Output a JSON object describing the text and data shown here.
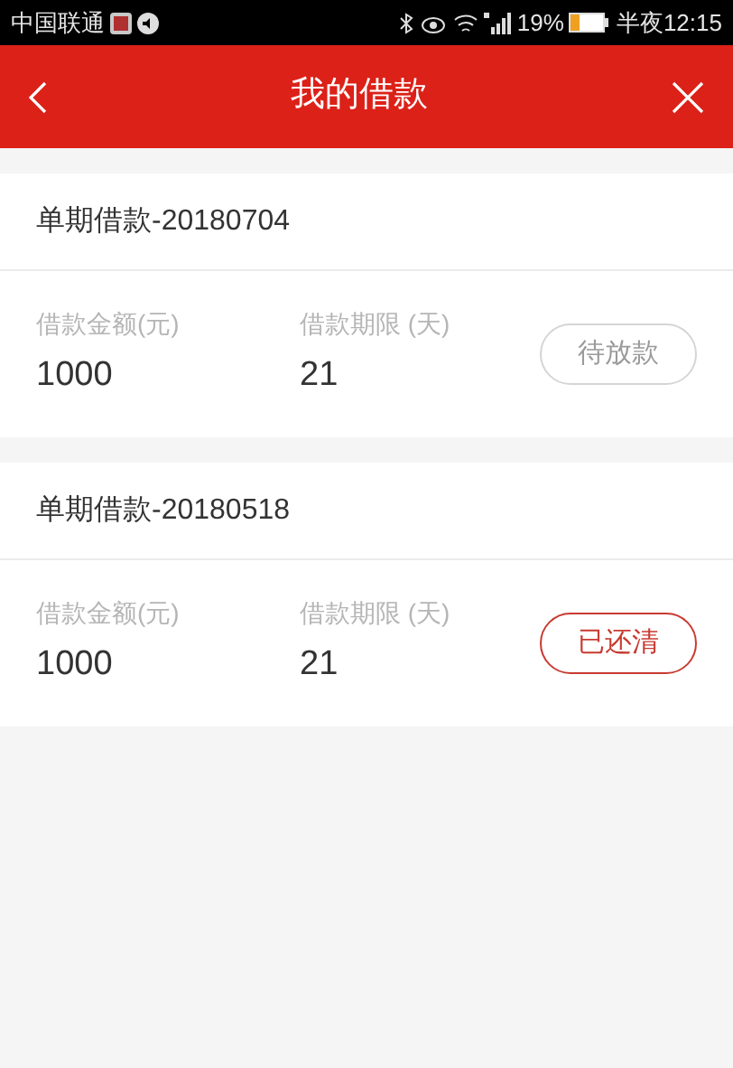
{
  "status_bar": {
    "carrier": "中国联通",
    "battery": "19%",
    "time": "半夜12:15"
  },
  "header": {
    "title": "我的借款"
  },
  "loans": [
    {
      "title": "单期借款-20180704",
      "amount_label": "借款金额(元)",
      "amount": "1000",
      "term_label": "借款期限 (天)",
      "term": "21",
      "status": {
        "kind": "pending",
        "label": "待放款"
      }
    },
    {
      "title": "单期借款-20180518",
      "amount_label": "借款金额(元)",
      "amount": "1000",
      "term_label": "借款期限 (天)",
      "term": "21",
      "status": {
        "kind": "cleared",
        "label": "已还清"
      }
    }
  ]
}
